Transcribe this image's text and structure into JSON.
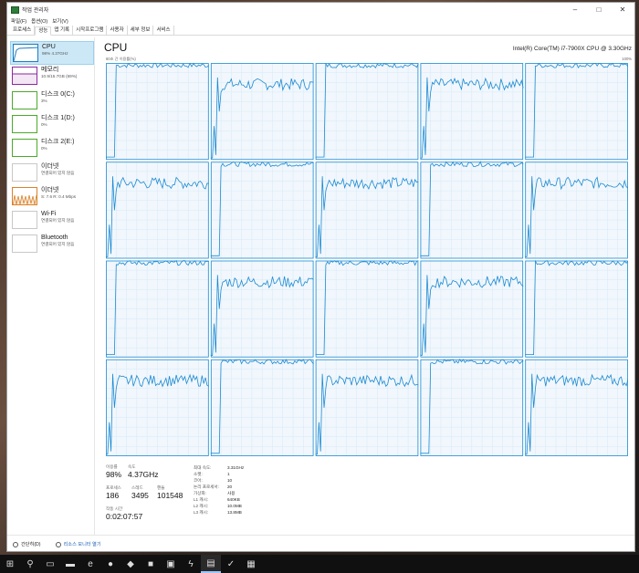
{
  "window": {
    "title": "작업 관리자",
    "controls": [
      "–",
      "□",
      "✕"
    ]
  },
  "menu": [
    "파일(F)",
    "옵션(O)",
    "보기(V)"
  ],
  "tabs": [
    "프로세스",
    "성능",
    "앱 기록",
    "시작프로그램",
    "사용자",
    "세부 정보",
    "서비스"
  ],
  "active_tab": "성능",
  "sidebar": [
    {
      "name": "CPU",
      "sub": "98% 4.37GHz",
      "color": "#1b7dc4",
      "icon": "cpu-graph-icon"
    },
    {
      "name": "메모리",
      "sub": "10.9/15.7GB (69%)",
      "color": "#8b2a9e",
      "icon": "memory-graph-icon"
    },
    {
      "name": "디스크 0(C:)",
      "sub": "3%",
      "color": "#4ca92b",
      "icon": "disk-graph-icon"
    },
    {
      "name": "디스크 1(D:)",
      "sub": "0%",
      "color": "#4ca92b",
      "icon": "disk-graph-icon"
    },
    {
      "name": "디스크 2(E:)",
      "sub": "0%",
      "color": "#4ca92b",
      "icon": "disk-graph-icon"
    },
    {
      "name": "이더넷",
      "sub": "연결되어 있지 않음",
      "color": "#c8c8c8",
      "icon": "ethernet-graph-icon"
    },
    {
      "name": "이더넷",
      "sub": "S: 7.6 R: 0.4 Mbps",
      "color": "#d9822b",
      "icon": "ethernet-graph-icon"
    },
    {
      "name": "Wi-Fi",
      "sub": "연결되어 있지 않음",
      "color": "#c8c8c8",
      "icon": "wifi-graph-icon"
    },
    {
      "name": "Bluetooth",
      "sub": "연결되어 있지 않음",
      "color": "#c8c8c8",
      "icon": "bluetooth-graph-icon"
    }
  ],
  "main": {
    "title": "CPU",
    "model": "Intel(R) Core(TM) i7-7900X CPU @ 3.30GHz",
    "graph_label_left": "60초 간 이용률(%)",
    "graph_label_right": "100%"
  },
  "cores": [
    {
      "active": false
    },
    {
      "active": true
    },
    {
      "active": false
    },
    {
      "active": true
    },
    {
      "active": false
    },
    {
      "active": true
    },
    {
      "active": false
    },
    {
      "active": true
    },
    {
      "active": false
    },
    {
      "active": true
    },
    {
      "active": false
    },
    {
      "active": true
    },
    {
      "active": false
    },
    {
      "active": true
    },
    {
      "active": false
    },
    {
      "active": true
    },
    {
      "active": false
    },
    {
      "active": true
    },
    {
      "active": false
    },
    {
      "active": true
    }
  ],
  "stats": {
    "utilization_label": "이용률",
    "utilization": "98%",
    "speed_label": "속도",
    "speed": "4.37GHz",
    "processes_label": "프로세스",
    "processes": "186",
    "threads_label": "스레드",
    "threads": "3495",
    "handles_label": "핸들",
    "handles": "101548",
    "uptime_label": "작동 시간",
    "uptime": "0:02:07:57"
  },
  "details": [
    {
      "k": "최대 속도:",
      "v": "3.31GHz"
    },
    {
      "k": "소켓:",
      "v": "1"
    },
    {
      "k": "코어:",
      "v": "10"
    },
    {
      "k": "논리 프로세서:",
      "v": "20"
    },
    {
      "k": "가상화:",
      "v": "사용"
    },
    {
      "k": "L1 캐시:",
      "v": "640KB"
    },
    {
      "k": "L2 캐시:",
      "v": "10.0MB"
    },
    {
      "k": "L3 캐시:",
      "v": "13.8MB"
    }
  ],
  "footer": {
    "fewer_details": "간단히(D)",
    "open_monitor": "리소스 모니터 열기"
  },
  "taskbar": [
    {
      "icon": "windows-start-icon",
      "glyph": "⊞"
    },
    {
      "icon": "search-icon",
      "glyph": "⚲"
    },
    {
      "icon": "task-view-icon",
      "glyph": "▭"
    },
    {
      "icon": "file-explorer-icon",
      "glyph": "▬"
    },
    {
      "icon": "edge-icon",
      "glyph": "e"
    },
    {
      "icon": "chrome-icon",
      "glyph": "●"
    },
    {
      "icon": "app-icon",
      "glyph": "◆"
    },
    {
      "icon": "kakaotalk-icon",
      "glyph": "■"
    },
    {
      "icon": "terminal-icon",
      "glyph": "▣"
    },
    {
      "icon": "app-red-icon",
      "glyph": "ϟ"
    },
    {
      "icon": "task-manager-icon",
      "glyph": "▤"
    },
    {
      "icon": "app-check-icon",
      "glyph": "✓"
    },
    {
      "icon": "app-yellow-icon",
      "glyph": "▦"
    }
  ],
  "colors": {
    "cpu_line": "#1b8ad2",
    "cpu_fill": "#f1f7fc",
    "cpu_grid": "#d6e9f7",
    "cpu_border": "#1b8ad2"
  }
}
